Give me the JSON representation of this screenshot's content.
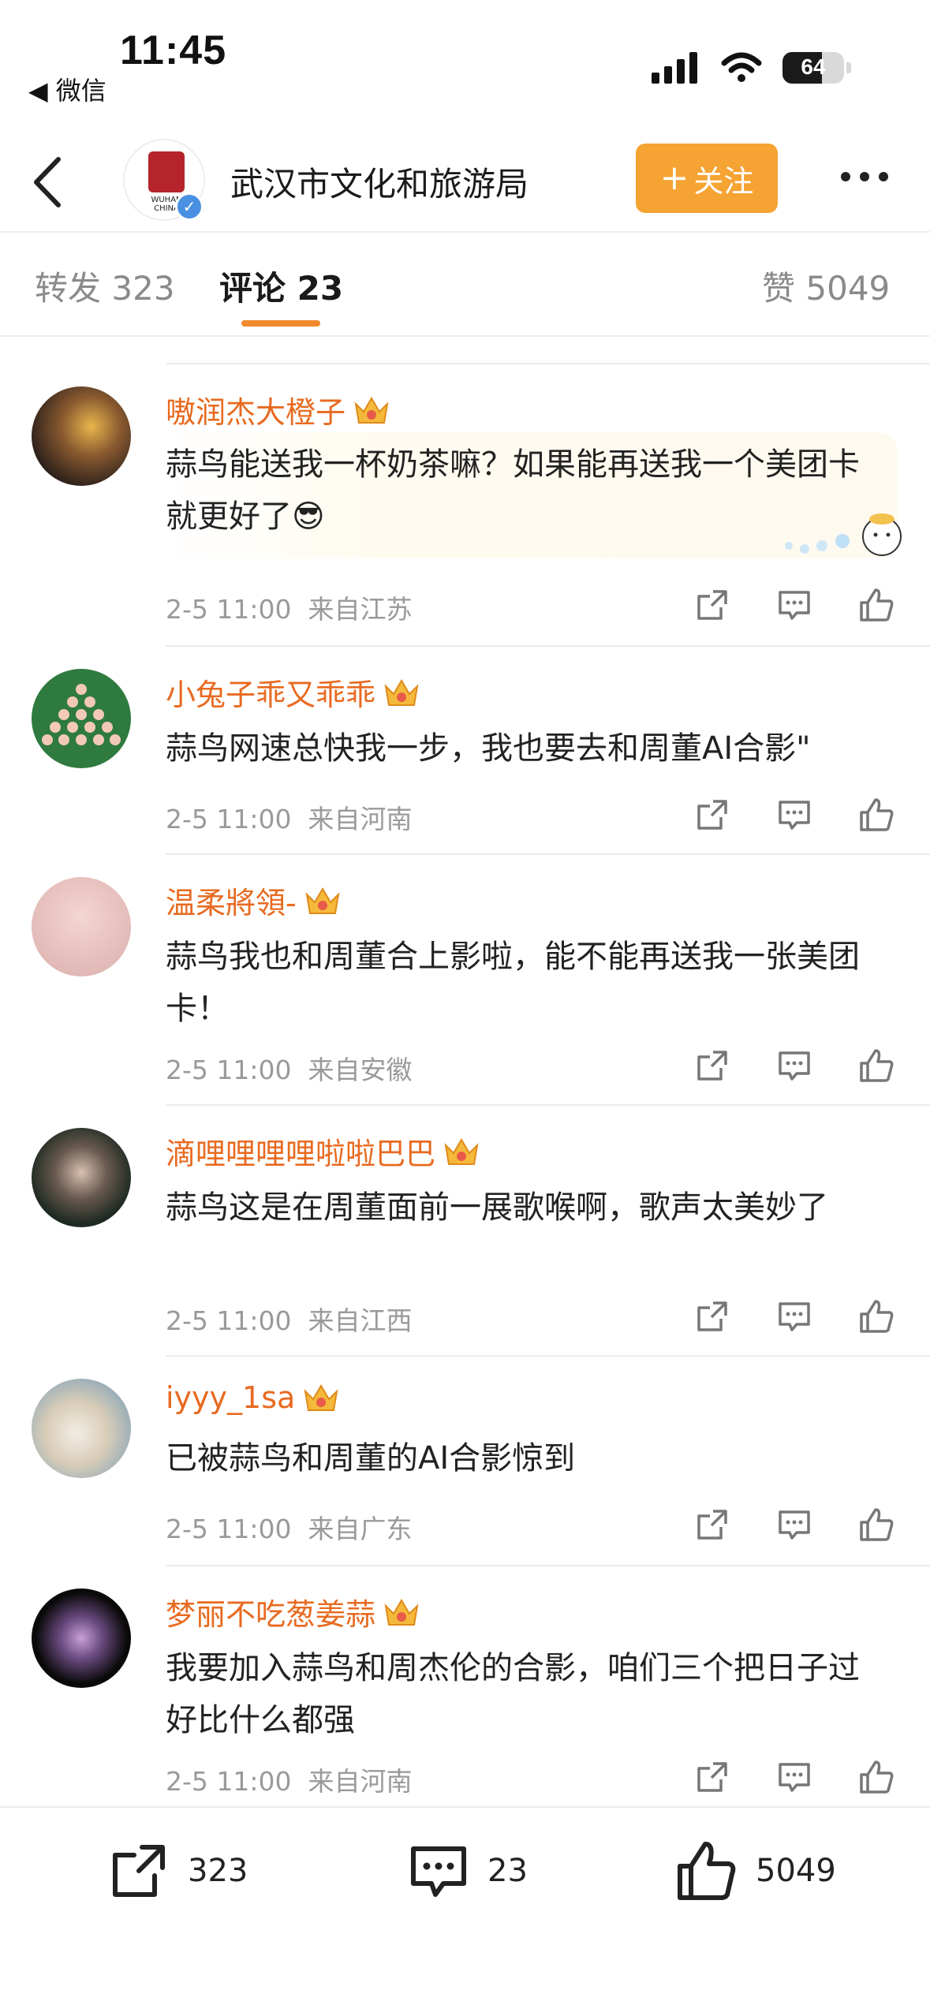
{
  "status_bar": {
    "time": "11:45",
    "back_app": "◀ 微信",
    "battery": "64",
    "battery_level": 0.64
  },
  "header": {
    "account_name": "武汉市文化和旅游局",
    "follow_label": "关注",
    "logo_text": "WUHAN CHINA"
  },
  "tabs": [
    {
      "label": "转发",
      "count": "323"
    },
    {
      "label": "评论",
      "count": "23"
    },
    {
      "label": "赞",
      "count": "5049"
    }
  ],
  "comments": [
    {
      "name": "嗷润杰大橙子",
      "text": "蒜鸟能送我一杯奶茶嘛？如果能再送我一个美团卡就更好了😎",
      "time": "2-5 11:00",
      "location": "来自江苏"
    },
    {
      "name": "小兔子乖又乖乖",
      "text": "蒜鸟网速总快我一步，我也要去和周董AI合影\"",
      "time": "2-5 11:00",
      "location": "来自河南"
    },
    {
      "name": "温柔將領-",
      "text": "蒜鸟我也和周董合上影啦，能不能再送我一张美团卡！",
      "time": "2-5 11:00",
      "location": "来自安徽"
    },
    {
      "name": "滴哩哩哩哩啦啦巴巴",
      "text": "蒜鸟这是在周董面前一展歌喉啊，歌声太美妙了",
      "time": "2-5 11:00",
      "location": "来自江西"
    },
    {
      "name": "iyyy_1sa",
      "text": "已被蒜鸟和周董的AI合影惊到",
      "time": "2-5 11:00",
      "location": "来自广东"
    },
    {
      "name": "梦丽不吃葱姜蒜",
      "text": "我要加入蒜鸟和周杰伦的合影，咱们三个把日子过好比什么都强",
      "time": "2-5 11:00",
      "location": "来自河南"
    }
  ],
  "bottom_bar": {
    "repost_count": "323",
    "comment_count": "23",
    "like_count": "5049"
  },
  "colors": {
    "accent": "#f5a332",
    "username": "#e86a20",
    "tab_underline": "#f08a2c",
    "meta": "#9a9a9a"
  }
}
